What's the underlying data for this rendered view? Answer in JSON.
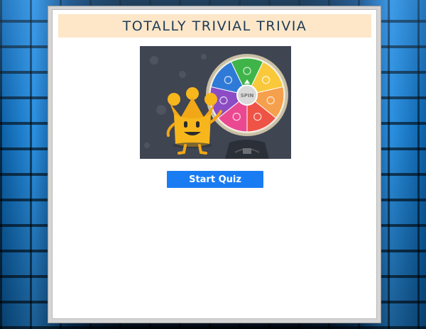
{
  "title": "TOTALLY TRIVIAL TRIVIA",
  "hero": {
    "spin_label": "SPIN",
    "icon": "trivia-crown-wheel-illustration",
    "wheel_colors": [
      "#3fb549",
      "#f9c93b",
      "#f5a04c",
      "#ee5446",
      "#ea4991",
      "#8c4cc4",
      "#2f7ad6"
    ]
  },
  "start_button": {
    "label": "Start Quiz"
  },
  "colors": {
    "title_bg": "#fde7c8",
    "title_text": "#1f3b57",
    "button_bg": "#1a7cf2"
  }
}
